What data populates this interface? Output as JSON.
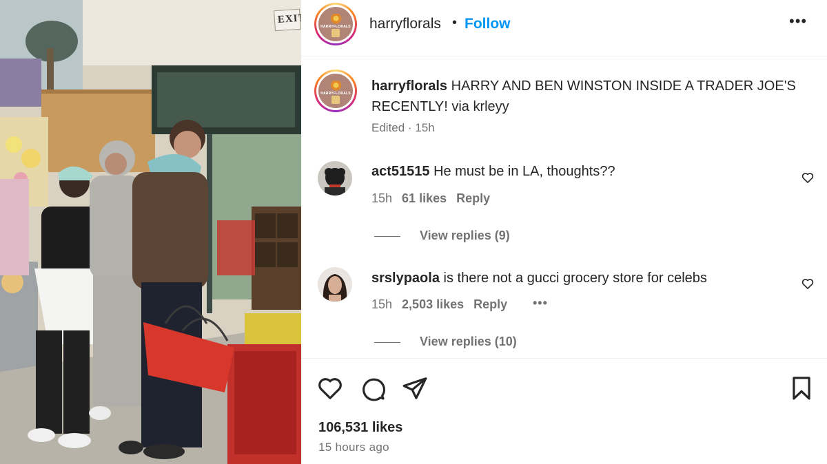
{
  "photo": {
    "exit_sign": "EXIT"
  },
  "header": {
    "username": "harryflorals",
    "separator": "•",
    "follow_label": "Follow",
    "more_label": "•••",
    "avatar_brand": "HARRYFLORALS"
  },
  "caption": {
    "username": "harryflorals",
    "text": "HARRY AND BEN WINSTON INSIDE A TRADER JOE'S RECENTLY! via krleyy",
    "meta": "Edited · 15h"
  },
  "comments": [
    {
      "username": "act51515",
      "text": "He must be in LA, thoughts??",
      "time": "15h",
      "likes": "61 likes",
      "reply": "Reply",
      "view_replies": "View replies (9)"
    },
    {
      "username": "srslypaola",
      "text": "is there not a gucci grocery store for celebs",
      "time": "15h",
      "likes": "2,503 likes",
      "reply": "Reply",
      "more": "•••",
      "view_replies": "View replies (10)"
    }
  ],
  "actions": {
    "likes_count": "106,531 likes",
    "time_ago": "15 hours ago"
  },
  "colors": {
    "accent": "#0095f6",
    "text": "#262626",
    "secondary": "#737373",
    "divider": "#efefef"
  }
}
